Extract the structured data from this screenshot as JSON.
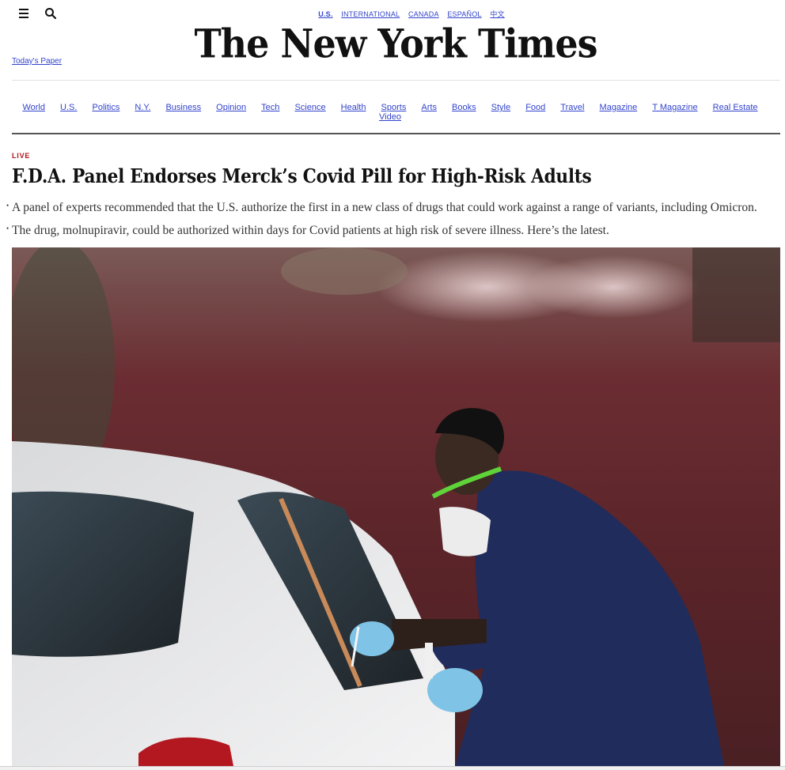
{
  "editions": [
    "U.S.",
    "INTERNATIONAL",
    "CANADA",
    "ESPAÑOL",
    "中文"
  ],
  "todays_paper": "Today's Paper",
  "masthead": "The New York Times",
  "sections": [
    "World",
    "U.S.",
    "Politics",
    "N.Y.",
    "Business",
    "Opinion",
    "Tech",
    "Science",
    "Health",
    "Sports",
    "Arts",
    "Books",
    "Style",
    "Food",
    "Travel",
    "Magazine",
    "T Magazine",
    "Real Estate",
    "Video"
  ],
  "story": {
    "kicker": "LIVE",
    "headline": "F.D.A. Panel Endorses Merck’s Covid Pill for High-Risk Adults",
    "summary": [
      "A panel of experts recommended that the U.S. authorize the first in a new class of drugs that could work against a range of variants, including Omicron.",
      "The drug, molnupiravir, could be authorized within days for Covid patients at high risk of severe illness. Here’s the latest."
    ]
  },
  "icons": {
    "menu": "hamburger-menu-icon",
    "search": "search-icon"
  },
  "colors": {
    "link": "#3344cc",
    "live": "#b1151a",
    "rule": "#555555"
  }
}
